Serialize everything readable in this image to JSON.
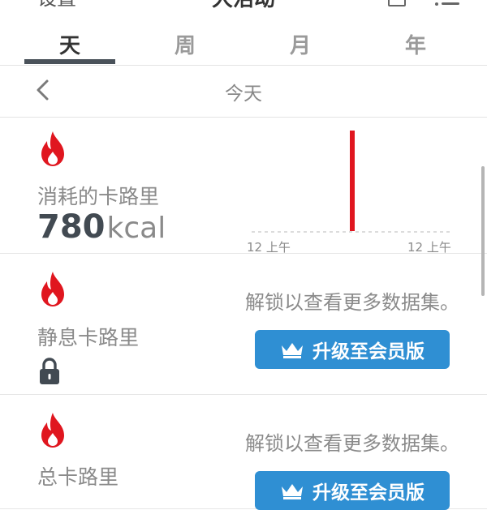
{
  "topbar": {
    "settings_label": "设置",
    "title": "大活动"
  },
  "tabs": [
    {
      "label": "天"
    },
    {
      "label": "周"
    },
    {
      "label": "月"
    },
    {
      "label": "年"
    }
  ],
  "active_tab": 0,
  "day_nav": {
    "label": "今天"
  },
  "colors": {
    "accent_red": "#e0161f",
    "button_blue": "#2f8fd3",
    "indicator": "#4a525a"
  },
  "cards": {
    "consumed": {
      "label": "消耗的卡路里",
      "value": "780",
      "unit": "kcal"
    },
    "resting": {
      "label": "静息卡路里",
      "unlock_text": "解锁以查看更多数据集。",
      "button_label": "升级至会员版"
    },
    "total": {
      "label": "总卡路里",
      "unlock_text": "解锁以查看更多数据集。",
      "button_label": "升级至会员版"
    }
  },
  "chart_data": {
    "type": "bar",
    "x_tick_labels": [
      "12 上午",
      "12 上午"
    ],
    "x_domain_hours": [
      0,
      24
    ],
    "bars": [
      {
        "hour": 12,
        "value": 780
      }
    ],
    "ylim": [
      0,
      780
    ],
    "color": "#e0161f",
    "baseline": "dotted"
  }
}
